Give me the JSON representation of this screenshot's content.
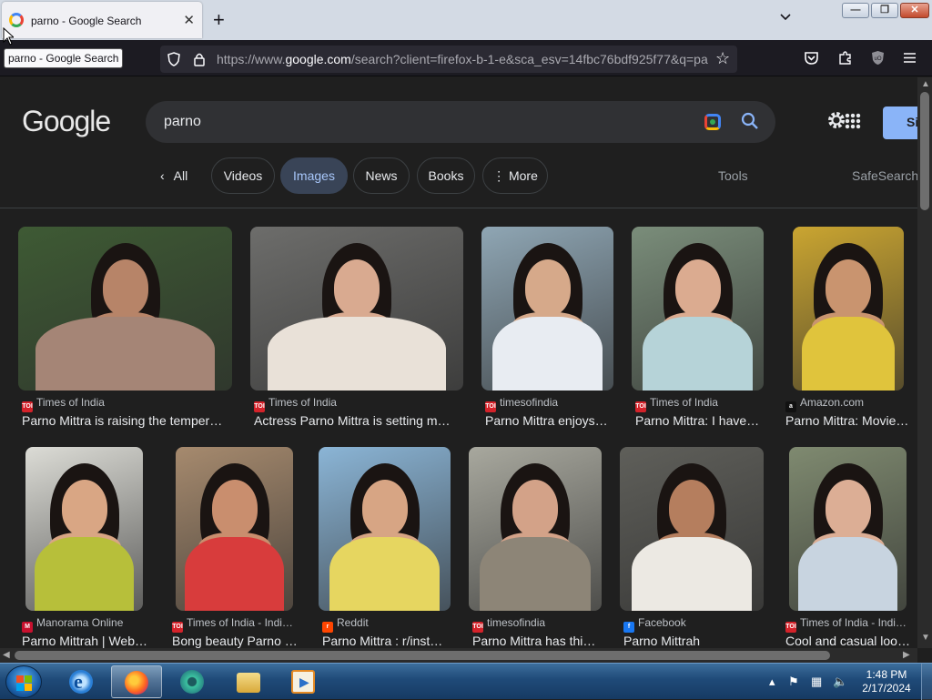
{
  "browser": {
    "tab_title": "parno - Google Search",
    "tooltip": "parno - Google Search",
    "url_prefix": "https://www.",
    "url_domain": "google.com",
    "url_rest": "/search?client=firefox-b-1-e&sca_esv=14fbc76bdf925f77&q=pa"
  },
  "google": {
    "logo": "Google",
    "query": "parno",
    "signin_label": "Si",
    "all_label": "All",
    "chips": [
      "Videos",
      "Images",
      "News",
      "Books",
      "More"
    ],
    "active_chip": "Images",
    "tools_label": "Tools",
    "safesearch_label": "SafeSearch"
  },
  "results": [
    {
      "source": "Times of India",
      "title": "Parno Mittra is raising the temperature…",
      "favicon": "toi",
      "bg": "#3e5a34",
      "skin": "#b78468",
      "top": "#a58576"
    },
    {
      "source": "Times of India",
      "title": "Actress Parno Mittra is setting m…",
      "favicon": "toi",
      "bg": "#6d6d6b",
      "skin": "#d9aa90",
      "top": "#e9e1d8"
    },
    {
      "source": "timesofindia",
      "title": "Parno Mittra enjoys…",
      "favicon": "toi",
      "bg": "#8fa6b4",
      "skin": "#d6a98a",
      "top": "#e8ecf2"
    },
    {
      "source": "Times of India",
      "title": "Parno Mittra: I have…",
      "favicon": "toi",
      "bg": "#7a8d7a",
      "skin": "#dbab90",
      "top": "#b6d3d8"
    },
    {
      "source": "Amazon.com",
      "title": "Parno Mittra: Movie…",
      "favicon": "amazon",
      "bg": "#caa531",
      "skin": "#c9946f",
      "top": "#e0c43c"
    },
    {
      "source": "Manorama Online",
      "title": "Parno Mittrah | Web…",
      "favicon": "manorama",
      "bg": "#dcdcd6",
      "skin": "#d9a684",
      "top": "#b7bf3a"
    },
    {
      "source": "Times of India - Indi…",
      "title": "Bong beauty Parno …",
      "favicon": "toi",
      "bg": "#a68a6e",
      "skin": "#c98e6e",
      "top": "#d83c3c"
    },
    {
      "source": "Reddit",
      "title": "Parno Mittra : r/inst…",
      "favicon": "reddit",
      "bg": "#8bb5d6",
      "skin": "#d7a584",
      "top": "#e6d660"
    },
    {
      "source": "timesofindia",
      "title": "Parno Mittra has thi…",
      "favicon": "toi",
      "bg": "#a8a89e",
      "skin": "#d3a288",
      "top": "#8d8577"
    },
    {
      "source": "Facebook",
      "title": "Parno Mittrah",
      "favicon": "facebook",
      "bg": "#5f5f5a",
      "skin": "#b57e5e",
      "top": "#ece9e3"
    },
    {
      "source": "Times of India - Indi…",
      "title": "Cool and casual loo…",
      "favicon": "toi",
      "bg": "#7f8a70",
      "skin": "#dcae95",
      "top": "#c8d4e0"
    }
  ],
  "favicons": {
    "toi": {
      "text": "TOI",
      "color": "#d4222a"
    },
    "amazon": {
      "text": "a",
      "color": "#111111"
    },
    "manorama": {
      "text": "M",
      "color": "#c8102e"
    },
    "reddit": {
      "text": "r",
      "color": "#ff4500"
    },
    "facebook": {
      "text": "f",
      "color": "#1877f2"
    }
  },
  "taskbar": {
    "time": "1:48 PM",
    "date": "2/17/2024",
    "apps": [
      "internet-explorer",
      "firefox",
      "chrome-like",
      "file-explorer",
      "media-player"
    ]
  }
}
